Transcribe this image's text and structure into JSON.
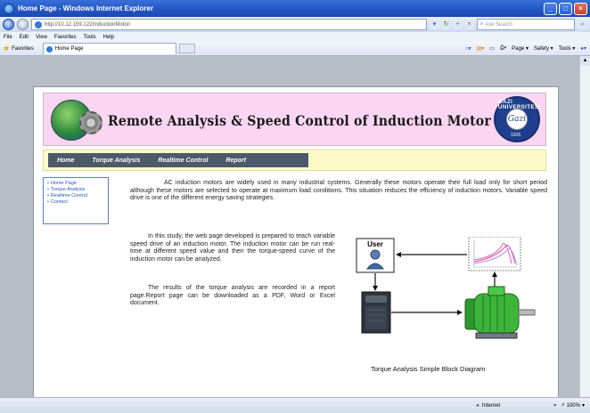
{
  "browser": {
    "title": "Home Page - Windows Internet Explorer",
    "address": "http://10.12.159.122/InductionMotor/",
    "search_placeholder": "Ask Search",
    "menu": [
      "File",
      "Edit",
      "View",
      "Favorites",
      "Tools",
      "Help"
    ],
    "favorites_label": "Favorites",
    "tab_label": "Home Page",
    "command_items": [
      "Page ▾",
      "Safety ▾",
      "Tools ▾"
    ],
    "status": {
      "zone": "Internet",
      "zoom": "100%"
    }
  },
  "page": {
    "banner_title": "Remote Analysis & Speed Control of Induction Motor",
    "seal": {
      "ring": "GAZI UNIVERSITESI",
      "year": "1926",
      "mark": "Gazi"
    },
    "nav": [
      "Home",
      "Torque Analysis",
      "Realtime Control",
      "Report"
    ],
    "sidebar": [
      "Home Page",
      "Torque Analysis",
      "Realtime Control",
      "Contact"
    ],
    "intro": "AC induction motors are widely used in many industrial systems. Generally these motors operate their full load only for short period although these motors are selected to operate at maximum load conditions. This situation reduces the efficiency of induction motors. Variable speed drive is one of the different energy saving strategies.",
    "para2": "In this study, the web page developed is prepared to teach variable speed drive of an induction motor. The induction motor can be run real-time at different speed value and then the torque-speed curve of the induction motor can be analyzed.",
    "para3": "The results of the torque analysis are recorded in a report page.Report page can be downloaded as a PDF, Word or Excel document.",
    "diagram": {
      "user_label": "User",
      "caption": "Torque Analysis Simple Block Diagram"
    }
  },
  "colors": {
    "banner_bg": "#fbd6f3",
    "nav_bg": "#4d5a6b",
    "nav_strip": "#fdfac8",
    "link": "#2b57b7",
    "motor": "#3db53a"
  }
}
